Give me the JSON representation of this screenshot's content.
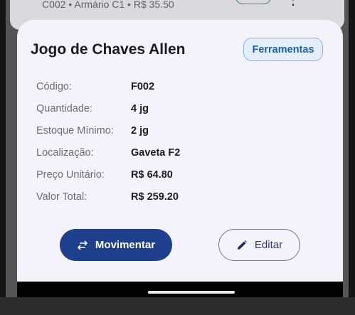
{
  "backdrop": {
    "item_subtitle": "C002 • Armário C1 • R$ 35.50"
  },
  "sheet": {
    "title": "Jogo de Chaves Allen",
    "category": "Ferramentas",
    "details": [
      {
        "label": "Código:",
        "value": "F002"
      },
      {
        "label": "Quantidade:",
        "value": "4 jg"
      },
      {
        "label": "Estoque Mínimo:",
        "value": "2 jg"
      },
      {
        "label": "Localização:",
        "value": "Gaveta F2"
      },
      {
        "label": "Preço Unitário:",
        "value": "R$ 64.80"
      },
      {
        "label": "Valor Total:",
        "value": "R$ 259.20"
      }
    ],
    "actions": {
      "move_label": "Movimentar",
      "edit_label": "Editar"
    }
  },
  "icons": {
    "move": "swap-arrows-icon",
    "edit": "pencil-icon",
    "more": "more-vertical-icon"
  },
  "colors": {
    "primary": "#1d3f8c",
    "chip_bg": "#e3effc",
    "chip_border": "#7cb5e8",
    "sheet_bg": "#f4f3fb"
  }
}
